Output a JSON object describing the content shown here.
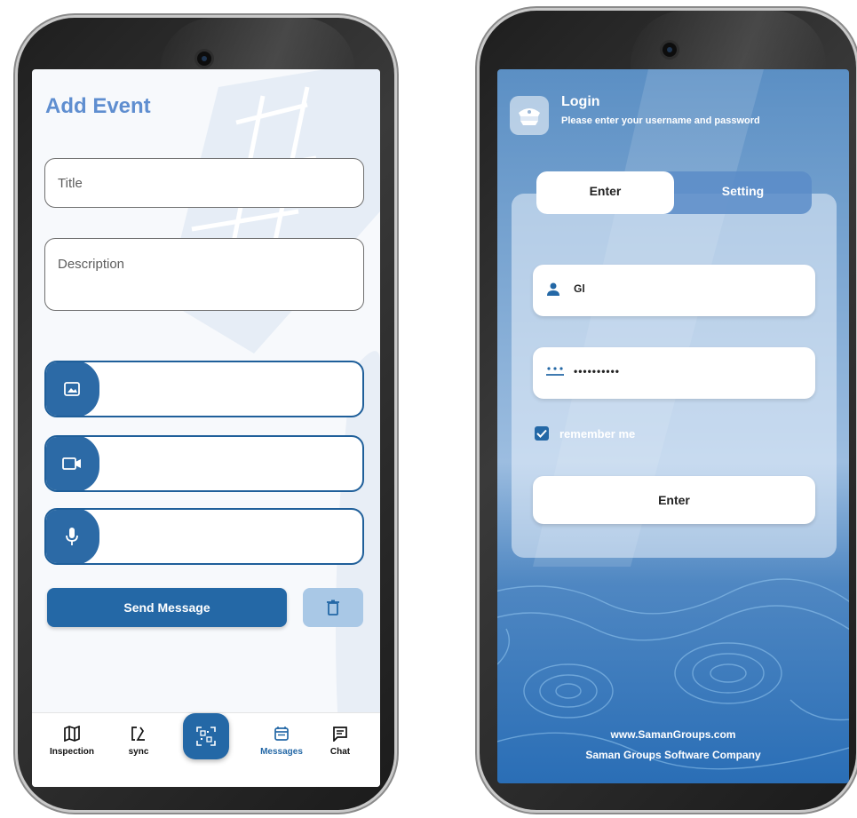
{
  "left_phone": {
    "title": "Add Event",
    "fields": {
      "title_placeholder": "Title",
      "description_placeholder": "Description"
    },
    "media": [
      {
        "icon": "image-icon"
      },
      {
        "icon": "video-camera-icon"
      },
      {
        "icon": "microphone-icon"
      }
    ],
    "send_label": "Send Message",
    "delete_icon": "trash-icon",
    "nav": [
      {
        "label": "Inspection",
        "icon": "map-icon",
        "active": false
      },
      {
        "label": "sync",
        "icon": "sync-icon",
        "active": false
      },
      {
        "label": "",
        "icon": "qr-scan-icon",
        "active": false
      },
      {
        "label": "Messages",
        "icon": "calendar-icon",
        "active": true
      },
      {
        "label": "Chat",
        "icon": "chat-icon",
        "active": false
      }
    ],
    "colors": {
      "primary": "#2468a6",
      "title": "#5f8ed0",
      "trash_bg": "#a9c8e6"
    }
  },
  "right_phone": {
    "header": {
      "title": "Login",
      "subtitle": "Please enter your username and password",
      "avatar_icon": "police-cap-icon"
    },
    "tabs": [
      {
        "label": "Enter",
        "active": true
      },
      {
        "label": "Setting",
        "active": false
      }
    ],
    "username": {
      "icon": "person-icon",
      "value": "Gl"
    },
    "password": {
      "icon": "password-icon",
      "value": "••••••••••"
    },
    "remember_label": "remember me",
    "remember_checked": true,
    "enter_label": "Enter",
    "footer": {
      "website": "www.SamanGroups.com",
      "company": "Saman Groups Software Company"
    }
  }
}
